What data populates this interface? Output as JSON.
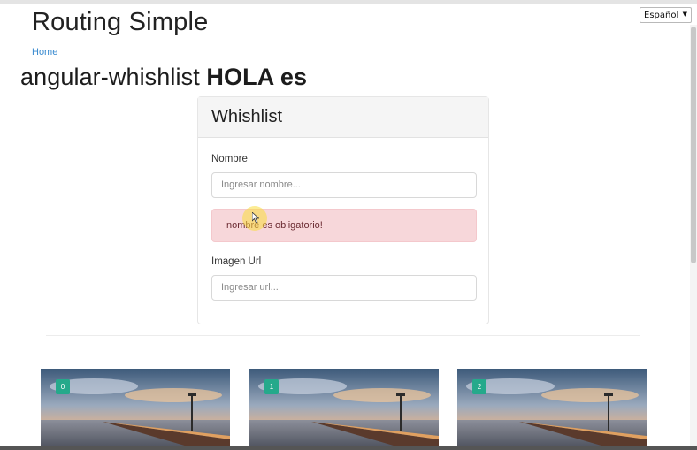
{
  "language_select": {
    "value": "Español"
  },
  "app": {
    "title": "Routing Simple"
  },
  "breadcrumb": {
    "home": "Home"
  },
  "heading": {
    "title": "angular-whishlist",
    "greeting": "HOLA es"
  },
  "form": {
    "header": "Whishlist",
    "nombre_label": "Nombre",
    "nombre_placeholder": "Ingresar nombre...",
    "error_message": "nombre es obligatorio!",
    "url_label": "Imagen Url",
    "url_placeholder": "Ingresar url..."
  },
  "destinations": [
    {
      "badge": "0"
    },
    {
      "badge": "1"
    },
    {
      "badge": "2"
    }
  ],
  "colors": {
    "accent": "#25a98b",
    "alert_bg": "#f7d7da",
    "link": "#3a8bd0"
  }
}
